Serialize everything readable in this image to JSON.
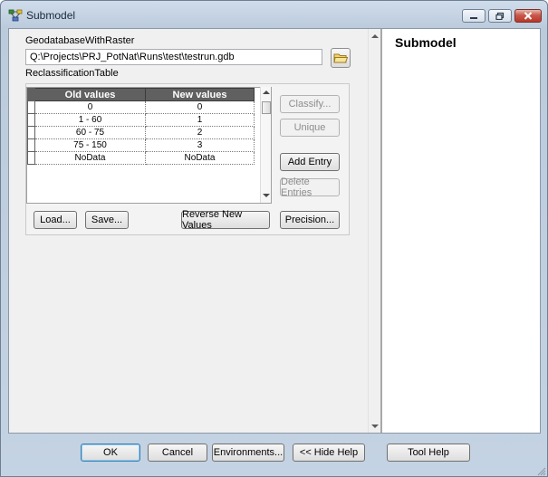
{
  "window": {
    "title": "Submodel"
  },
  "form": {
    "gdb_label": "GeodatabaseWithRaster",
    "gdb_value": "Q:\\Projects\\PRJ_PotNat\\Runs\\test\\testrun.gdb",
    "reclass_label": "ReclassificationTable"
  },
  "table": {
    "headers": [
      "Old values",
      "New values"
    ],
    "rows": [
      [
        "0",
        "0"
      ],
      [
        "1 - 60",
        "1"
      ],
      [
        "60 - 75",
        "2"
      ],
      [
        "75 - 150",
        "3"
      ],
      [
        "NoData",
        "NoData"
      ]
    ]
  },
  "side_buttons": {
    "classify": "Classify...",
    "unique": "Unique",
    "add_entry": "Add Entry",
    "delete_entries": "Delete Entries"
  },
  "table_buttons": {
    "load": "Load...",
    "save": "Save...",
    "reverse": "Reverse New Values",
    "precision": "Precision..."
  },
  "help": {
    "title": "Submodel"
  },
  "footer": {
    "ok": "OK",
    "cancel": "Cancel",
    "environments": "Environments...",
    "hide_help": "<< Hide Help",
    "tool_help": "Tool Help"
  },
  "colors": {
    "title_bar": "#c4d3e3",
    "header_bg": "#606060",
    "close_button": "#c9574a"
  },
  "icons": {
    "app": "model-tool-icon",
    "folder": "open-folder-icon"
  }
}
